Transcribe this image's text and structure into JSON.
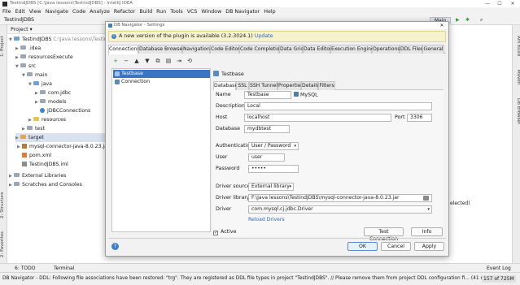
{
  "window": {
    "title": "TestindJDBS [C:\\Java lessons\\TestindJDBS] - IntelliJ IDEA",
    "controls": [
      "—",
      "☐",
      "✕"
    ]
  },
  "menu": [
    "File",
    "Edit",
    "View",
    "Navigate",
    "Code",
    "Analyze",
    "Refactor",
    "Build",
    "Run",
    "Tools",
    "VCS",
    "Window",
    "DB Navigator",
    "Help"
  ],
  "toolbar": {
    "breadcrumb": "TestindJDBS",
    "run_config": "Main"
  },
  "left_strip": [
    "1: Project",
    "2: Structure",
    "2: Favorites"
  ],
  "right_strip": [
    "Ant Build",
    "Maven",
    "DB Browser"
  ],
  "project": {
    "header": "Project",
    "tree": [
      {
        "label": "TestindJDBS",
        "suffix": "C:\\Java lessons\\TestindJDBS",
        "icon": "folder-icon"
      },
      {
        "label": ".idea",
        "icon": "folder-icon"
      },
      {
        "label": "resourcesExecute",
        "icon": "folder-icon"
      },
      {
        "label": "src",
        "icon": "folder-icon"
      },
      {
        "label": "main",
        "icon": "folder-icon"
      },
      {
        "label": "java",
        "icon": "folder-icon"
      },
      {
        "label": "com.jdbc",
        "icon": "package-icon"
      },
      {
        "label": "models",
        "icon": "package-icon"
      },
      {
        "label": "JDBCConnections",
        "icon": "class-icon"
      },
      {
        "label": "resources",
        "icon": "folder-icon"
      },
      {
        "label": "test",
        "icon": "folder-icon"
      },
      {
        "label": "target",
        "icon": "folder-icon"
      },
      {
        "label": "mysql-connector-java-8.0.23.jar",
        "icon": "jar-icon"
      },
      {
        "label": "pom.xml",
        "icon": "xml-icon"
      },
      {
        "label": "TestindJDBS.iml",
        "icon": "iml-icon"
      },
      {
        "label": "External Libraries",
        "icon": "library-icon"
      },
      {
        "label": "Scratches and Consoles",
        "icon": "scratch-icon"
      }
    ]
  },
  "editor": {
    "hint": "elected)"
  },
  "dialog": {
    "title": "DB Navigator - Settings",
    "notice": {
      "text": "A new version of the plugin is available (3.2.3024.1)",
      "link": "Update"
    },
    "tabs": [
      "Connections",
      "Database Browser",
      "Navigation",
      "Code Editor",
      "Code Completion",
      "Data Grid",
      "Data Editor",
      "Execution Engine",
      "Operations",
      "DDL Files",
      "General"
    ],
    "connections": [
      "Testbase",
      "Connection"
    ],
    "selected_connection": "Testbase",
    "subtabs": [
      "Database",
      "SSL",
      "SSH Tunnel",
      "Properties",
      "Details",
      "Filters"
    ],
    "form": {
      "name_label": "Name",
      "name_value": "Testbase",
      "db_type": "MySQL",
      "description_label": "Description",
      "description_value": "Local",
      "host_label": "Host",
      "host_value": "localhost",
      "port_label": "Port",
      "port_value": "3306",
      "database_label": "Database",
      "database_value": "mydbtest",
      "auth_label": "Authentication",
      "auth_value": "User / Password",
      "user_label": "User",
      "user_value": "user",
      "password_label": "Password",
      "password_value": "•••••",
      "driver_source_label": "Driver source",
      "driver_source_value": "External library",
      "driver_library_label": "Driver library",
      "driver_library_value": "F:\\Java lessons\\TestindJDBS\\mysql-connector-java-8.0.23.jar",
      "driver_label": "Driver",
      "driver_value": "com.mysql.cj.jdbc.Driver",
      "reload_link": "Reload Drivers"
    },
    "active_label": "Active",
    "buttons": {
      "test": "Test Connection",
      "info": "Info",
      "ok": "OK",
      "cancel": "Cancel",
      "apply": "Apply"
    }
  },
  "bottom_tabs": [
    "6: TODO",
    "Terminal",
    "Event Log"
  ],
  "status": {
    "text": "DB Navigator - DDL: Following file associations have been restored: \"trg\". They are registered as DDL file types in project \"TestindJDBS\". // Please remove them from project DDL configuration fi... (41 minutes ago)",
    "position": "157 of 725M"
  },
  "colors": {
    "selection": "#3a75c4",
    "link": "#2a66c9",
    "notice_bg": "#f6f1cf"
  }
}
